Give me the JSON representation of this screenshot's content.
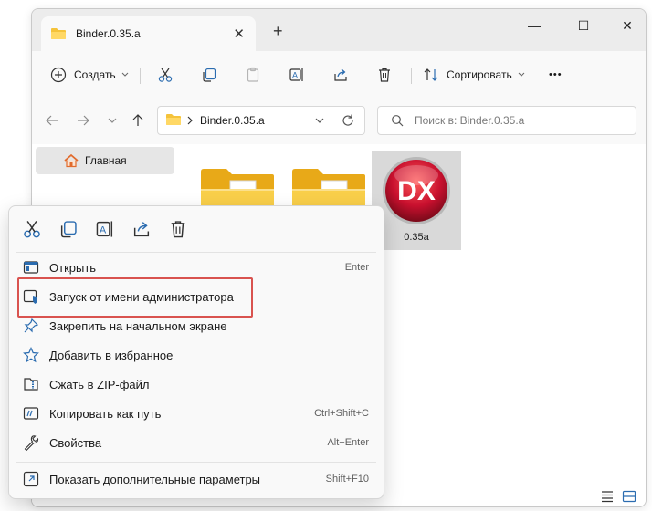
{
  "window": {
    "tab_title": "Binder.0.35.a",
    "new_tab": "+",
    "tab_close": "✕",
    "controls": {
      "minimize": "—",
      "maximize": "☐",
      "close": "✕"
    }
  },
  "toolbar": {
    "create_label": "Создать",
    "sort_label": "Сортировать",
    "more": "•••"
  },
  "address": {
    "path": "Binder.0.35.a",
    "search_placeholder": "Поиск в: Binder.0.35.a"
  },
  "nav": {
    "home_label": "Главная"
  },
  "files": [
    {
      "name": "",
      "type": "folder"
    },
    {
      "name": "",
      "type": "folder"
    },
    {
      "name": "0.35a",
      "type": "app",
      "icon_text": "DX"
    }
  ],
  "context_menu": {
    "items": [
      {
        "label": "Открыть",
        "shortcut": "Enter"
      },
      {
        "label": "Запуск от имени администратора",
        "shortcut": ""
      },
      {
        "label": "Закрепить на начальном экране",
        "shortcut": ""
      },
      {
        "label": "Добавить в избранное",
        "shortcut": ""
      },
      {
        "label": "Сжать в ZIP-файл",
        "shortcut": ""
      },
      {
        "label": "Копировать как путь",
        "shortcut": "Ctrl+Shift+C"
      },
      {
        "label": "Свойства",
        "shortcut": "Alt+Enter"
      },
      {
        "label": "Показать дополнительные параметры",
        "shortcut": "Shift+F10"
      }
    ]
  },
  "colors": {
    "accent": "#0067c0",
    "highlight": "#d9534f",
    "folder": "#f5c33b",
    "dx_red": "#c8102e"
  }
}
